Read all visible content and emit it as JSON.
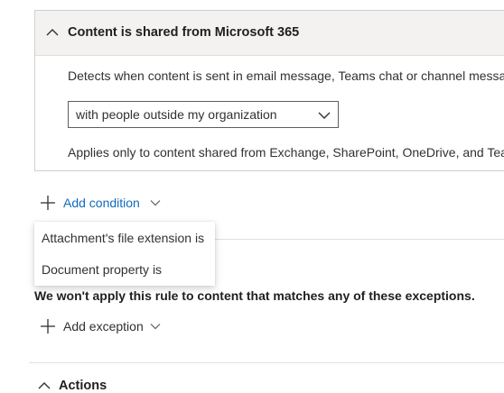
{
  "condition_card": {
    "title": "Content is shared from Microsoft 365",
    "description": "Detects when content is sent in email message, Teams chat or channel message",
    "scope_dropdown": {
      "selected": "with people outside my organization"
    },
    "note": "Applies only to content shared from Exchange, SharePoint, OneDrive, and Teams"
  },
  "add_condition": {
    "label": "Add condition",
    "menu_items": [
      "Attachment's file extension is",
      "Document property is"
    ]
  },
  "exceptions": {
    "description": "We won't apply this rule to content that matches any of these exceptions.",
    "add_label": "Add exception"
  },
  "actions": {
    "title": "Actions"
  },
  "colors": {
    "accent": "#0f6cbd",
    "header_bg": "#f3f2f1",
    "border": "#d2d0ce"
  },
  "icons": {
    "collapse": "chevron-up-icon",
    "dropdown": "chevron-down-icon",
    "add": "plus-icon"
  }
}
